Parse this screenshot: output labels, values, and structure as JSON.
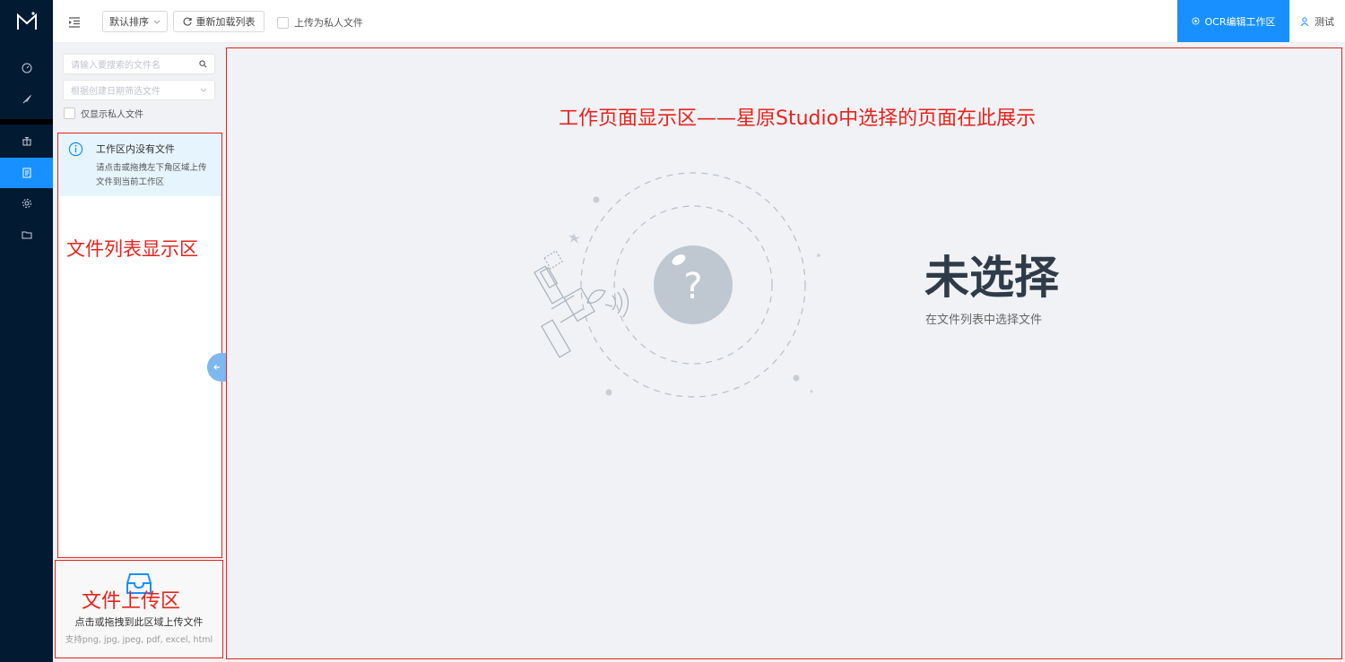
{
  "colors": {
    "nav_bg": "#031a33",
    "accent": "#1890ff",
    "annotation_red": "#e5231d"
  },
  "nav": {
    "items": [
      {
        "icon": "dashboard-icon"
      },
      {
        "icon": "rocket-icon"
      },
      {
        "icon": "gift-icon"
      },
      {
        "icon": "document-icon",
        "active": true
      },
      {
        "icon": "gear-icon"
      },
      {
        "icon": "folder-icon"
      }
    ]
  },
  "toolbar": {
    "sort_label": "默认排序",
    "reload_label": "重新加载列表",
    "private_upload_label": "上传为私人文件",
    "ocr_button_label": "OCR编辑工作区",
    "user_name": "测试"
  },
  "sidebar": {
    "search_placeholder": "请输入要搜索的文件名",
    "date_filter_placeholder": "根据创建日期筛选文件",
    "private_only_label": "仅显示私人文件",
    "notice_title": "工作区内没有文件",
    "notice_body_line1": "请点击或拖拽左下角区域上传",
    "notice_body_line2": "文件到当前工作区",
    "upload_hint": "点击或拖拽到此区域上传文件",
    "upload_formats": "支持png, jpg, jpeg, pdf, excel, html"
  },
  "annotations": {
    "main_area": "工作页面显示区——星原Studio中选择的页面在此展示",
    "file_list": "文件列表显示区",
    "upload_area": "文件上传区"
  },
  "empty_state": {
    "title": "未选择",
    "subtitle": "在文件列表中选择文件"
  }
}
